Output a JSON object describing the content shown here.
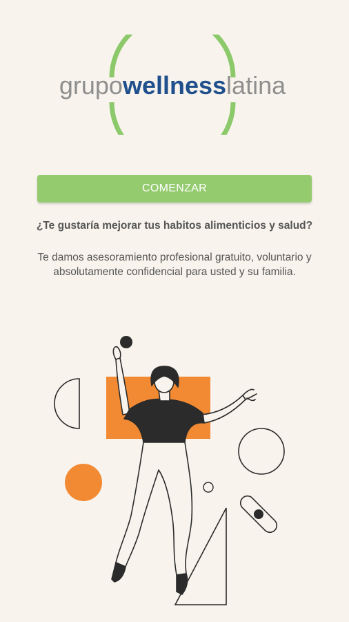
{
  "logo": {
    "word_grupo": "grupo",
    "word_wellness": "wellness",
    "word_latina": "latina",
    "colors": {
      "gray": "#8e8e8e",
      "blue": "#1f4f8c",
      "green": "#8bc96a"
    }
  },
  "start_button": {
    "label": "COMENZAR",
    "color": "#94cb6f"
  },
  "question": "¿Te gustaría mejorar tus habitos alimenticios y salud?",
  "description": "Te damos asesoramiento profesional gratuito, voluntario y absolutamente confidencial para usted y su familia.",
  "illustration": {
    "accent_color": "#f28a34",
    "line_color": "#2b2b2b"
  }
}
